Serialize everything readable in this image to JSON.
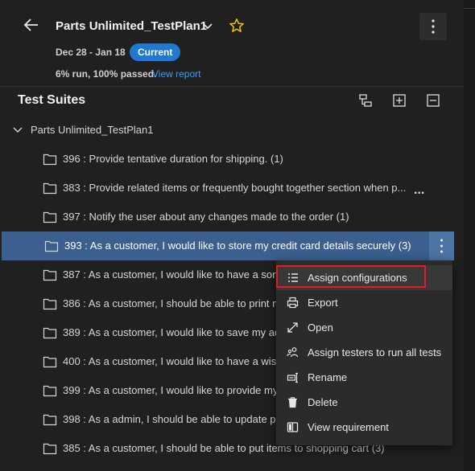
{
  "header": {
    "title": "Parts Unlimited_TestPlan1",
    "dates": "Dec 28 - Jan 18",
    "badge": "Current",
    "summary": "6% run, 100% passed.",
    "report_link": "View report"
  },
  "suites": {
    "title": "Test Suites",
    "root": "Parts Unlimited_TestPlan1",
    "items": [
      {
        "label": "396 : Provide tentative duration for shipping. (1)"
      },
      {
        "label": "383 : Provide related items or frequently bought together section when p..."
      },
      {
        "label": "397 : Notify the user about any changes made to the order (1)"
      },
      {
        "label": "393 : As a customer, I would like to store my credit card details securely (3)"
      },
      {
        "label": "387 : As a customer, I would like to have a sort"
      },
      {
        "label": "386 : As a customer, I should be able to print m"
      },
      {
        "label": "389 : As a customer, I would like to save my ad"
      },
      {
        "label": "400 : As a customer, I would like to have a wish"
      },
      {
        "label": "399 : As a customer, I would like to provide my"
      },
      {
        "label": "398 : As a admin, I should be able to update pr"
      },
      {
        "label": "385 : As a customer, I should be able to put items to shopping cart (3)"
      }
    ],
    "ellipsis": "..."
  },
  "menu": {
    "items": [
      {
        "label": "Assign configurations",
        "icon": "list-icon"
      },
      {
        "label": "Export",
        "icon": "print-icon"
      },
      {
        "label": "Open",
        "icon": "expand-icon"
      },
      {
        "label": "Assign testers to run all tests",
        "icon": "people-icon"
      },
      {
        "label": "Rename",
        "icon": "rename-icon"
      },
      {
        "label": "Delete",
        "icon": "trash-icon"
      },
      {
        "label": "View requirement",
        "icon": "book-icon"
      }
    ]
  },
  "colors": {
    "background": "#202020",
    "accent": "#1f78d1",
    "link": "#3b9cff",
    "star": "#f2c200",
    "selected_row": "#3b5f8f",
    "focus_outline": "#e51c23"
  }
}
